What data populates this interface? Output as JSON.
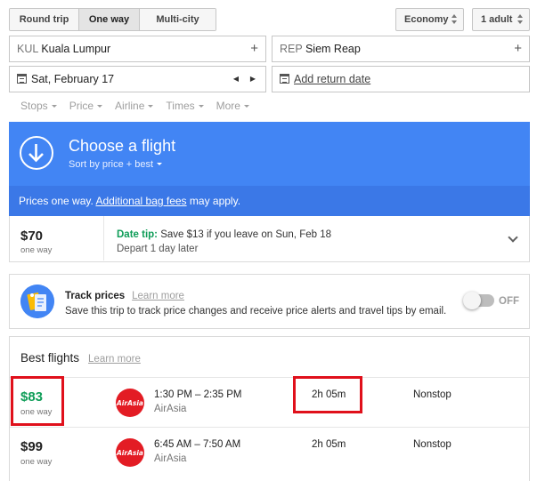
{
  "trip_type": {
    "options": [
      "Round trip",
      "One way",
      "Multi-city"
    ],
    "selected": "One way"
  },
  "cabin": {
    "label": "Economy"
  },
  "passengers": {
    "label": "1 adult"
  },
  "origin": {
    "code": "KUL",
    "city": "Kuala Lumpur"
  },
  "destination": {
    "code": "REP",
    "city": "Siem Reap"
  },
  "depart_date": "Sat, February 17",
  "return_date_link": "Add return date",
  "filters": [
    "Stops",
    "Price",
    "Airline",
    "Times",
    "More"
  ],
  "banner": {
    "title": "Choose a flight",
    "subtitle": "Sort by price + best"
  },
  "notice": {
    "prefix": "Prices one way.",
    "link": "Additional bag fees",
    "suffix": "may apply."
  },
  "date_tip": {
    "price": "$70",
    "price_sub": "one way",
    "label": "Date tip:",
    "text": "Save $13 if you leave on Sun, Feb 18",
    "line2": "Depart 1 day later"
  },
  "track": {
    "title": "Track prices",
    "learn_more": "Learn more",
    "desc": "Save this trip to track price changes and receive price alerts and travel tips by email.",
    "toggle_label": "OFF",
    "enabled": false
  },
  "best": {
    "title": "Best flights",
    "learn_more": "Learn more",
    "flights": [
      {
        "price": "$83",
        "price_sub": "one way",
        "time": "1:30 PM – 2:35 PM",
        "airline": "AirAsia",
        "logo_text": "AirAsia",
        "duration": "2h 05m",
        "stops": "Nonstop",
        "price_color": "#0f9d58"
      },
      {
        "price": "$99",
        "price_sub": "one way",
        "time": "6:45 AM – 7:50 AM",
        "airline": "AirAsia",
        "logo_text": "AirAsia",
        "duration": "2h 05m",
        "stops": "Nonstop",
        "price_color": "#212121"
      }
    ]
  },
  "colors": {
    "primary_blue": "#4285f4",
    "notice_blue": "#3b78e7",
    "accent_green": "#0f9d58",
    "highlight_red": "#e0101b",
    "airasia_red": "#e31c24"
  }
}
